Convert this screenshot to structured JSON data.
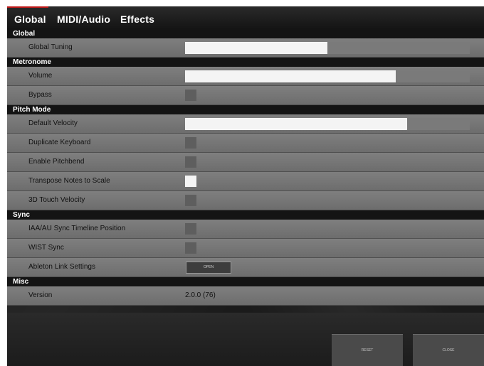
{
  "tabs": [
    {
      "label": "Global",
      "active": true
    },
    {
      "label": "MIDI/Audio",
      "active": false
    },
    {
      "label": "Effects",
      "active": false
    }
  ],
  "sections": {
    "global": {
      "title": "Global",
      "global_tuning": {
        "label": "Global Tuning",
        "level": 0.5
      }
    },
    "metronome": {
      "title": "Metronome",
      "volume": {
        "label": "Volume",
        "level": 0.74
      },
      "bypass": {
        "label": "Bypass",
        "checked": false
      }
    },
    "pitch_mode": {
      "title": "Pitch Mode",
      "default_velocity": {
        "label": "Default Velocity",
        "level": 0.78
      },
      "duplicate_keyboard": {
        "label": "Duplicate Keyboard",
        "checked": false
      },
      "enable_pitchbend": {
        "label": "Enable Pitchbend",
        "checked": false
      },
      "transpose_notes": {
        "label": "Transpose Notes to Scale",
        "checked": true
      },
      "touch_velocity": {
        "label": "3D Touch Velocity",
        "checked": false
      }
    },
    "sync": {
      "title": "Sync",
      "iaa_au": {
        "label": "IAA/AU Sync Timeline Position",
        "checked": false
      },
      "wist": {
        "label": "WIST Sync",
        "checked": false
      },
      "ableton": {
        "label": "Ableton Link Settings",
        "button_label": "OPEN"
      }
    },
    "misc": {
      "title": "Misc",
      "version": {
        "label": "Version",
        "value": "2.0.0 (76)"
      }
    }
  },
  "footer": {
    "reset_label": "RESET",
    "close_label": "CLOSE"
  },
  "colors": {
    "accent": "#c01a1a",
    "section_bg": "#141414",
    "row_bg": "#787878",
    "control_on": "#f4f4f4",
    "control_off": "#5e5e5e"
  }
}
